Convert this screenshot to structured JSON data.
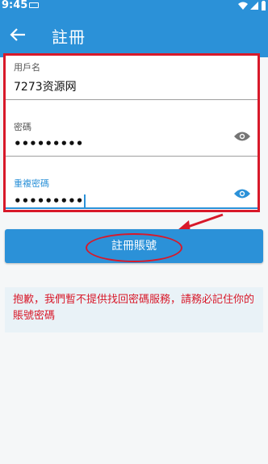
{
  "status_bar": {
    "time": "9:45"
  },
  "app_bar": {
    "title": "註冊"
  },
  "form": {
    "username": {
      "label": "用戶名",
      "value": "7273资源网"
    },
    "password": {
      "label": "密碼",
      "value": "•••••••••"
    },
    "confirm_password": {
      "label": "重複密碼",
      "value": "•••••••••"
    }
  },
  "submit_button": {
    "label": "註冊賬號"
  },
  "notice": {
    "text": "抱歉，我們暫不提供找回密碼服務，請務必記住你的賬號密碼"
  },
  "colors": {
    "primary": "#2b91d8",
    "annotation_red": "#d8192a",
    "notice_bg": "#e9f2f7"
  }
}
